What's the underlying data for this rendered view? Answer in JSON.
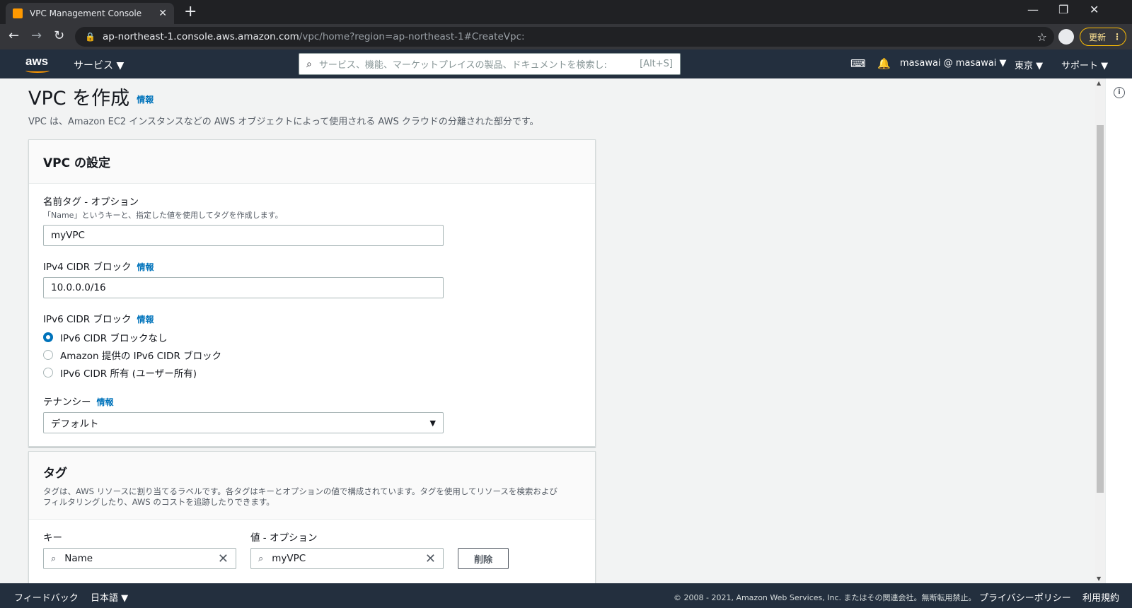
{
  "browser": {
    "tab_title": "VPC Management Console",
    "url_host": "ap-northeast-1.console.aws.amazon.com",
    "url_path": "/vpc/home?region=ap-northeast-1#CreateVpc:",
    "update_label": "更新"
  },
  "aws_header": {
    "logo": "aws",
    "services_label": "サービス ▼",
    "search_placeholder": "サービス、機能、マーケットプレイスの製品、ドキュメントを検索し:",
    "search_shortcut": "[Alt+S]",
    "account_label": "masawai @ masawai ▼",
    "region_label": "東京 ▼",
    "support_label": "サポート ▼"
  },
  "page": {
    "title": "VPC を作成",
    "info": "情報",
    "description": "VPC は、Amazon EC2 インスタンスなどの AWS オブジェクトによって使用される AWS クラウドの分離された部分です。"
  },
  "vpc_settings": {
    "title": "VPC の設定",
    "name_tag": {
      "label": "名前タグ - オプション",
      "description": "「Name」というキーと、指定した値を使用してタグを作成します。",
      "value": "myVPC"
    },
    "ipv4": {
      "label": "IPv4 CIDR ブロック",
      "info": "情報",
      "value": "10.0.0.0/16"
    },
    "ipv6": {
      "label": "IPv6 CIDR ブロック",
      "info": "情報",
      "options": [
        "IPv6 CIDR ブロックなし",
        "Amazon 提供の IPv6 CIDR ブロック",
        "IPv6 CIDR 所有 (ユーザー所有)"
      ],
      "selected_index": 0
    },
    "tenancy": {
      "label": "テナンシー",
      "info": "情報",
      "value": "デフォルト"
    }
  },
  "tags": {
    "title": "タグ",
    "description_line1": "タグは、AWS リソースに割り当てるラベルです。各タグはキーとオプションの値で構成されています。タグを使用してリソースを検索および",
    "description_line2": "フィルタリングしたり、AWS のコストを追跡したりできます。",
    "key_label": "キー",
    "value_label": "値 - オプション",
    "rows": [
      {
        "key": "Name",
        "value": "myVPC"
      }
    ],
    "delete_label": "削除"
  },
  "footer": {
    "feedback": "フィードバック",
    "language": "日本語 ▼",
    "copyright": "© 2008 - 2021, Amazon Web Services, Inc. またはその関連会社。無断転用禁止。",
    "privacy": "プライバシーポリシー",
    "terms": "利用規約"
  }
}
